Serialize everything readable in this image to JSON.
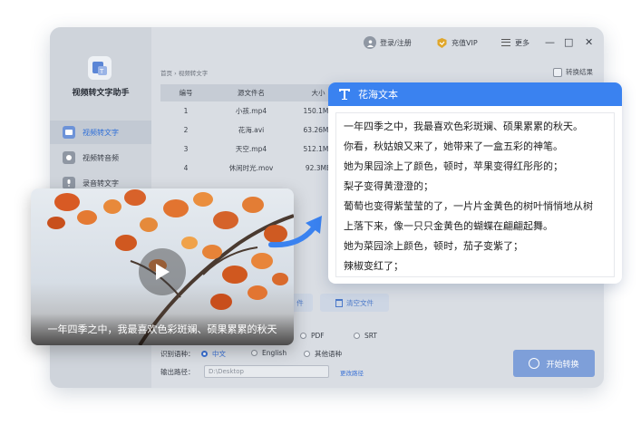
{
  "app": {
    "name": "视频转文字助手",
    "nav": [
      {
        "label": "视频转文字",
        "active": true
      },
      {
        "label": "视频转音频",
        "active": false
      },
      {
        "label": "录音转文字",
        "active": false
      }
    ]
  },
  "topbar": {
    "login": "登录/注册",
    "vip": "充值VIP",
    "more": "更多",
    "minimize": "—",
    "maximize": "□",
    "close": "✕"
  },
  "breadcrumb": "首页 › 视频转文字",
  "result_toggle": "转换结果",
  "table": {
    "headers": [
      "编号",
      "源文件名",
      "大小"
    ],
    "rows": [
      {
        "no": "1",
        "name": "小孩.mp4",
        "size": "150.1MB"
      },
      {
        "no": "2",
        "name": "花海.avi",
        "size": "63.26MB"
      },
      {
        "no": "3",
        "name": "天空.mp4",
        "size": "512.1MB"
      },
      {
        "no": "4",
        "name": "休闲时光.mov",
        "size": "92.3MB"
      }
    ]
  },
  "buttons": {
    "add_partial": "件",
    "clear": "清空文件",
    "start": "开始转换"
  },
  "format": {
    "options": [
      "PDF",
      "SRT"
    ]
  },
  "language": {
    "label": "识别语种：",
    "options": [
      {
        "label": "中文",
        "selected": true
      },
      {
        "label": "English",
        "selected": false
      },
      {
        "label": "其他语种",
        "selected": false
      }
    ]
  },
  "output": {
    "label": "输出路径：",
    "path": "D:\\Desktop",
    "change": "更改路径"
  },
  "video": {
    "caption": "一年四季之中，我最喜欢色彩斑斓、硕果累累的秋天"
  },
  "panel": {
    "title": "花海文本",
    "lines": [
      "一年四季之中，我最喜欢色彩斑斓、硕果累累的秋天。",
      "你看，秋姑娘又来了，她带来了一盒五彩的神笔。",
      "她为果园涂上了颜色，顿时，苹果变得红彤彤的；",
      "梨子变得黄澄澄的；",
      "葡萄也变得紫莹莹的了，一片片金黄色的树叶悄悄地从树",
      "上落下来，像一只只金黄色的蝴蝶在翩翩起舞。",
      "她为菜园涂上颜色，顿时，茄子变紫了；",
      "辣椒变红了；"
    ]
  },
  "colors": {
    "accent": "#3a82f0",
    "dim_window": "#d9dde3"
  }
}
